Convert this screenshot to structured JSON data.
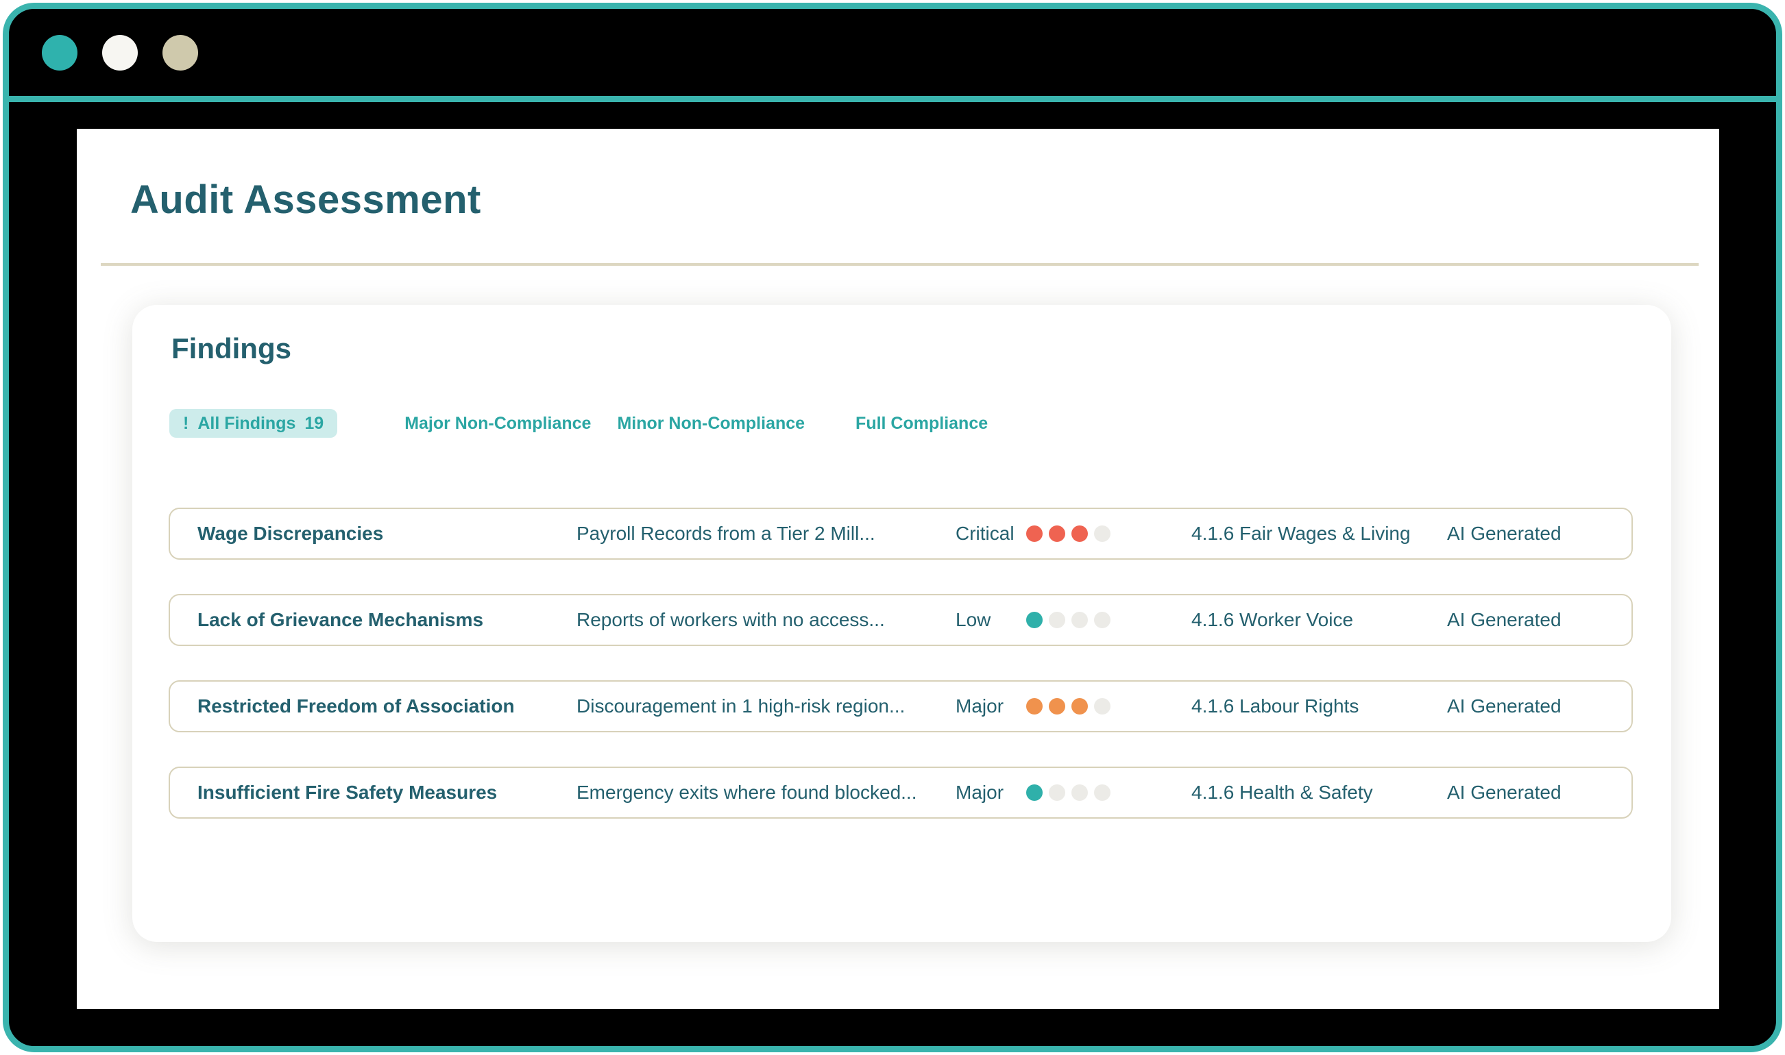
{
  "window": {
    "controls": [
      {
        "name": "teal",
        "color": "#2fb2ad"
      },
      {
        "name": "white",
        "color": "#f7f6f2"
      },
      {
        "name": "tan",
        "color": "#cfc9ac"
      }
    ]
  },
  "page": {
    "title": "Audit Assessment"
  },
  "findings": {
    "heading": "Findings",
    "filters": {
      "active_icon": "!",
      "active_label": "All Findings",
      "active_count": "19",
      "tabs": [
        "Major Non-Compliance",
        "Minor Non-Compliance",
        "Full Compliance"
      ]
    },
    "rows": [
      {
        "title": "Wage Discrepancies",
        "description": "Payroll Records from a Tier 2 Mill...",
        "severity": "Critical",
        "dot_color": "#ef6351",
        "dots_filled": 3,
        "dots_total": 4,
        "category": "4.1.6 Fair Wages & Living",
        "tag": "AI Generated"
      },
      {
        "title": "Lack of Grievance Mechanisms",
        "description": "Reports of workers with no access...",
        "severity": "Low",
        "dot_color": "#2fb0aa",
        "dots_filled": 1,
        "dots_total": 4,
        "category": "4.1.6 Worker Voice",
        "tag": "AI Generated"
      },
      {
        "title": "Restricted Freedom of Association",
        "description": "Discouragement in 1 high-risk region...",
        "severity": "Major",
        "dot_color": "#f0924d",
        "dots_filled": 3,
        "dots_total": 4,
        "category": "4.1.6 Labour Rights",
        "tag": "AI Generated"
      },
      {
        "title": "Insufficient Fire Safety Measures",
        "description": "Emergency exits where found blocked...",
        "severity": "Major",
        "dot_color": "#2fb0aa",
        "dots_filled": 1,
        "dots_total": 4,
        "category": "4.1.6 Health & Safety",
        "tag": "AI Generated"
      }
    ]
  },
  "colors": {
    "accent": "#3ab4ae",
    "ink": "#24606e",
    "tab_teal": "#2ba6a3",
    "pill_bg": "#cdeceb",
    "row_border": "#d8d2ba",
    "rule": "#ddd7c1",
    "dot_empty": "#ecebe7"
  }
}
